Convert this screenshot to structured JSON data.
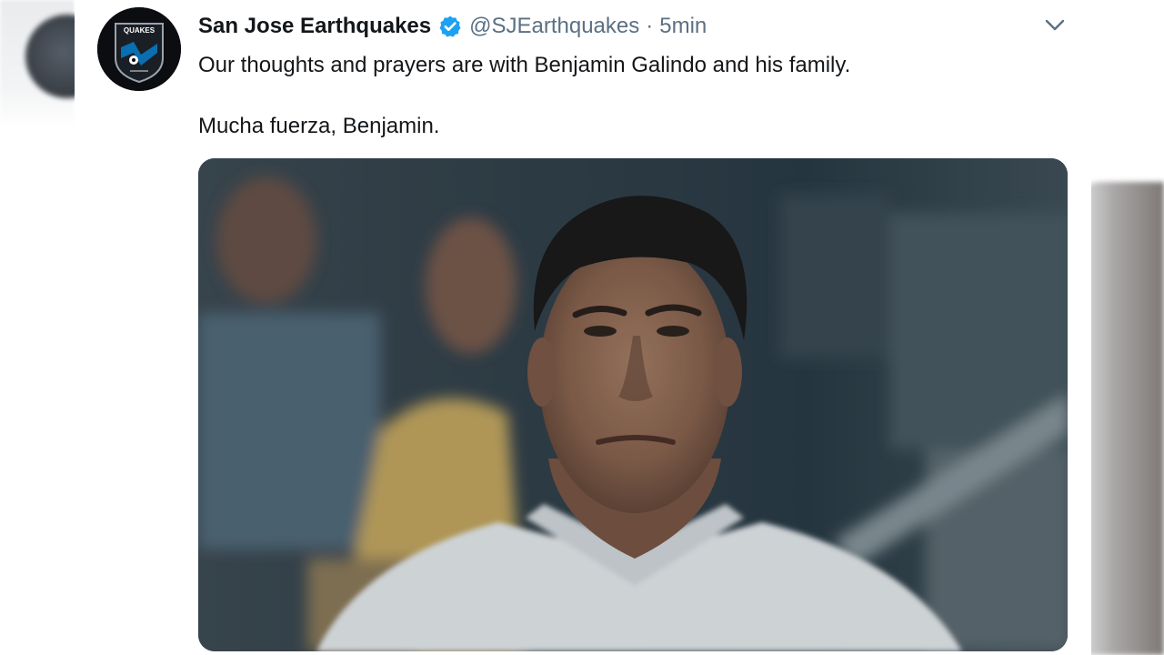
{
  "tweet": {
    "author_name": "San Jose Earthquakes",
    "handle": "@SJEarthquakes",
    "separator": "·",
    "time": "5min",
    "lines": [
      "Our thoughts and prayers are with Benjamin Galindo and his family.",
      "Mucha fuerza, Benjamin."
    ],
    "avatar_logo_text": "QUAKES",
    "verified": true
  },
  "icons": {
    "verified": "verified-badge-icon",
    "caret": "chevron-down-icon"
  },
  "colors": {
    "name": "#14171a",
    "secondary": "#5b7083",
    "verified": "#1da1f2",
    "avatar_bg": "#0b0d10",
    "logo_blue": "#0a6fb0"
  }
}
